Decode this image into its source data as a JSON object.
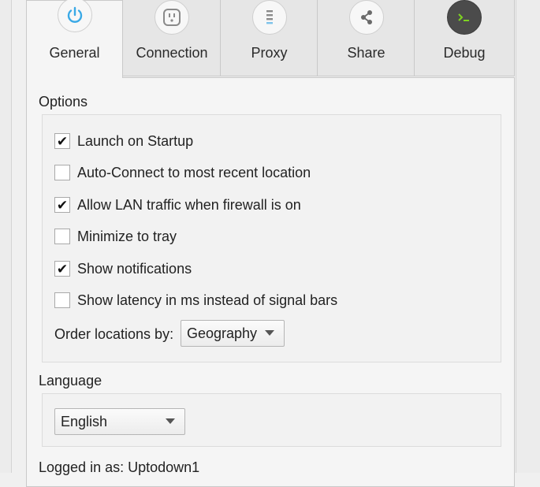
{
  "tabs": [
    {
      "label": "General",
      "icon": "power-icon",
      "active": true
    },
    {
      "label": "Connection",
      "icon": "plug-icon",
      "active": false
    },
    {
      "label": "Proxy",
      "icon": "proxy-list-icon",
      "active": false
    },
    {
      "label": "Share",
      "icon": "share-icon",
      "active": false
    },
    {
      "label": "Debug",
      "icon": "terminal-icon",
      "active": false
    }
  ],
  "options": {
    "title": "Options",
    "items": [
      {
        "label": "Launch on Startup",
        "checked": true,
        "mark": "✔"
      },
      {
        "label": "Auto-Connect to most recent location",
        "checked": false,
        "mark": ""
      },
      {
        "label": "Allow LAN traffic when firewall is on",
        "checked": true,
        "mark": "✔"
      },
      {
        "label": "Minimize to tray",
        "checked": false,
        "mark": ""
      },
      {
        "label": "Show notifications",
        "checked": true,
        "mark": "✔"
      },
      {
        "label": "Show latency in ms instead of signal bars",
        "checked": false,
        "mark": ""
      }
    ],
    "order_label": "Order locations by:",
    "order_value": "Geography"
  },
  "language": {
    "title": "Language",
    "value": "English"
  },
  "status": {
    "logged_in": "Logged in as: Uptodown1"
  },
  "colors": {
    "power_icon": "#3aa9e6",
    "debug_icon_bg": "#4b4b4b",
    "debug_icon_fg": "#7ed321"
  }
}
